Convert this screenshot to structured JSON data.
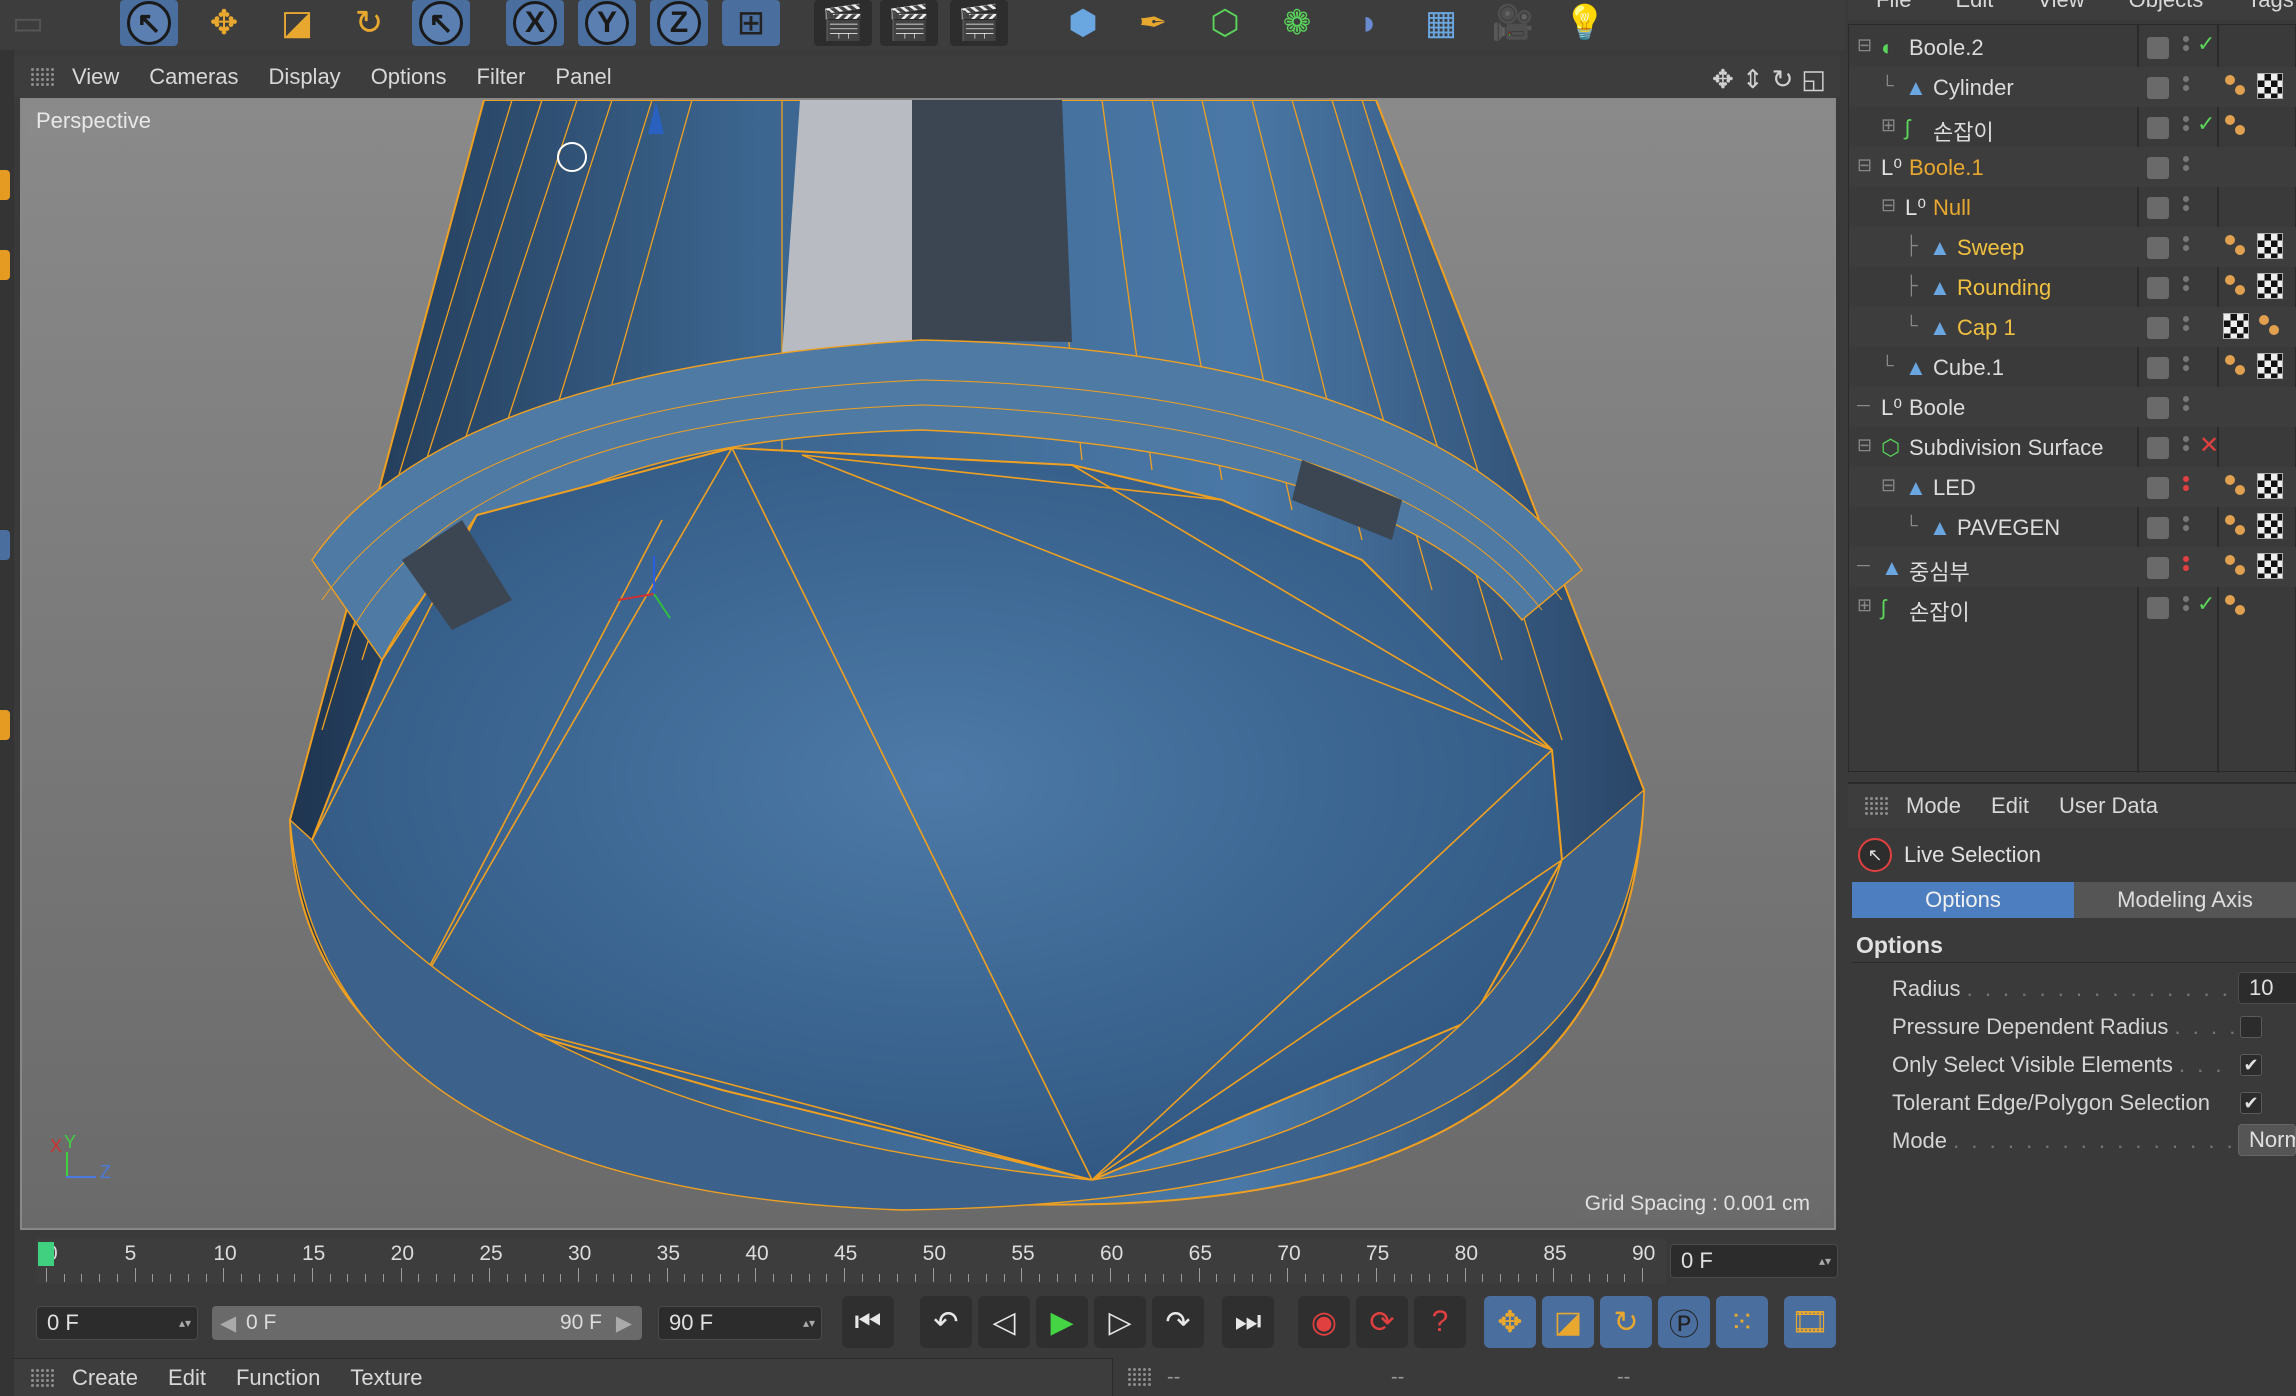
{
  "viewport": {
    "menu": [
      "View",
      "Cameras",
      "Display",
      "Options",
      "Filter",
      "Panel"
    ],
    "label": "Perspective",
    "grid_spacing": "Grid Spacing : 0.001 cm",
    "axis": {
      "x": "X",
      "y": "Y",
      "z": "Z"
    }
  },
  "toolbar": {
    "axis_buttons": [
      "X",
      "Y",
      "Z"
    ]
  },
  "timeline": {
    "ticks": [
      "0",
      "5",
      "10",
      "15",
      "20",
      "25",
      "30",
      "35",
      "40",
      "45",
      "50",
      "55",
      "60",
      "65",
      "70",
      "75",
      "80",
      "85",
      "90"
    ],
    "current_frame": "0 F",
    "start_field": "0 F",
    "range_start": "0 F",
    "range_end": "90 F",
    "end_field": "90 F"
  },
  "bottom_menu": [
    "Create",
    "Edit",
    "Function",
    "Texture"
  ],
  "coord_placeholders": [
    "--",
    "--",
    "--"
  ],
  "object_manager": {
    "menu": [
      "File",
      "Edit",
      "View",
      "Objects",
      "Tags"
    ],
    "objects": [
      {
        "name": "Boole.2",
        "tree": "⊟",
        "indent": 0,
        "icon": "boole-icon",
        "color": "normal",
        "status": "ok",
        "dots": "gray",
        "tags": []
      },
      {
        "name": "Cylinder",
        "tree": "└",
        "indent": 1,
        "icon": "polygon-icon",
        "color": "normal",
        "status": "none",
        "dots": "gray",
        "tags": [
          "phong",
          "mat"
        ]
      },
      {
        "name": "손잡이",
        "tree": "⊞",
        "indent": 1,
        "icon": "spline-icon",
        "color": "normal",
        "status": "ok",
        "dots": "gray",
        "tags": [
          "phong"
        ]
      },
      {
        "name": "Boole.1",
        "tree": "⊟",
        "indent": 0,
        "icon": "null-icon",
        "color": "orange",
        "status": "none",
        "dots": "gray",
        "tags": []
      },
      {
        "name": "Null",
        "tree": "⊟",
        "indent": 1,
        "icon": "null-icon",
        "color": "orange",
        "status": "none",
        "dots": "gray",
        "tags": []
      },
      {
        "name": "Sweep",
        "tree": "├",
        "indent": 2,
        "icon": "polygon-icon",
        "color": "yellow",
        "status": "none",
        "dots": "gray",
        "tags": [
          "phong",
          "mat"
        ]
      },
      {
        "name": "Rounding",
        "tree": "├",
        "indent": 2,
        "icon": "polygon-icon",
        "color": "yellow",
        "status": "none",
        "dots": "gray",
        "tags": [
          "phong",
          "mat"
        ]
      },
      {
        "name": "Cap 1",
        "tree": "└",
        "indent": 2,
        "icon": "polygon-icon",
        "color": "yellow",
        "status": "none",
        "dots": "gray",
        "tags": [
          "mat",
          "phong"
        ]
      },
      {
        "name": "Cube.1",
        "tree": "└",
        "indent": 1,
        "icon": "polygon-icon",
        "color": "normal",
        "status": "none",
        "dots": "gray",
        "tags": [
          "phong",
          "mat"
        ]
      },
      {
        "name": "Boole",
        "tree": "─",
        "indent": 0,
        "icon": "null-icon",
        "color": "normal",
        "status": "none",
        "dots": "gray",
        "tags": []
      },
      {
        "name": "Subdivision Surface",
        "tree": "⊟",
        "indent": 0,
        "icon": "subdivision-icon",
        "color": "normal",
        "status": "x",
        "dots": "gray",
        "tags": []
      },
      {
        "name": "LED",
        "tree": "⊟",
        "indent": 1,
        "icon": "polygon-icon",
        "color": "normal",
        "status": "none",
        "dots": "red",
        "tags": [
          "phong",
          "mat"
        ]
      },
      {
        "name": "PAVEGEN",
        "tree": "└",
        "indent": 2,
        "icon": "polygon-icon",
        "color": "normal",
        "status": "none",
        "dots": "gray",
        "tags": [
          "phong",
          "mat"
        ]
      },
      {
        "name": "중심부",
        "tree": "─",
        "indent": 0,
        "icon": "polygon-icon",
        "color": "normal",
        "status": "none",
        "dots": "red",
        "tags": [
          "phong",
          "mat"
        ]
      },
      {
        "name": "손잡이",
        "tree": "⊞",
        "indent": 0,
        "icon": "spline-icon",
        "color": "normal",
        "status": "ok",
        "dots": "gray",
        "tags": [
          "phong"
        ]
      }
    ]
  },
  "attribute_manager": {
    "menu": [
      "Mode",
      "Edit",
      "User Data"
    ],
    "tool_name": "Live Selection",
    "tabs": [
      "Options",
      "Modeling Axis"
    ],
    "section": "Options",
    "radius_label": "Radius",
    "radius_value": "10",
    "pressure_label": "Pressure Dependent Radius",
    "pressure_checked": false,
    "visible_label": "Only Select Visible Elements",
    "visible_checked": true,
    "tolerant_label": "Tolerant Edge/Polygon Selection",
    "tolerant_checked": true,
    "mode_label": "Mode",
    "mode_value": "Norm"
  },
  "colors": {
    "accent": "#e8a830",
    "selection_tab": "#4d7fc0",
    "wire_edge": "#f0a020",
    "mesh_blue": "#3f6a96"
  }
}
